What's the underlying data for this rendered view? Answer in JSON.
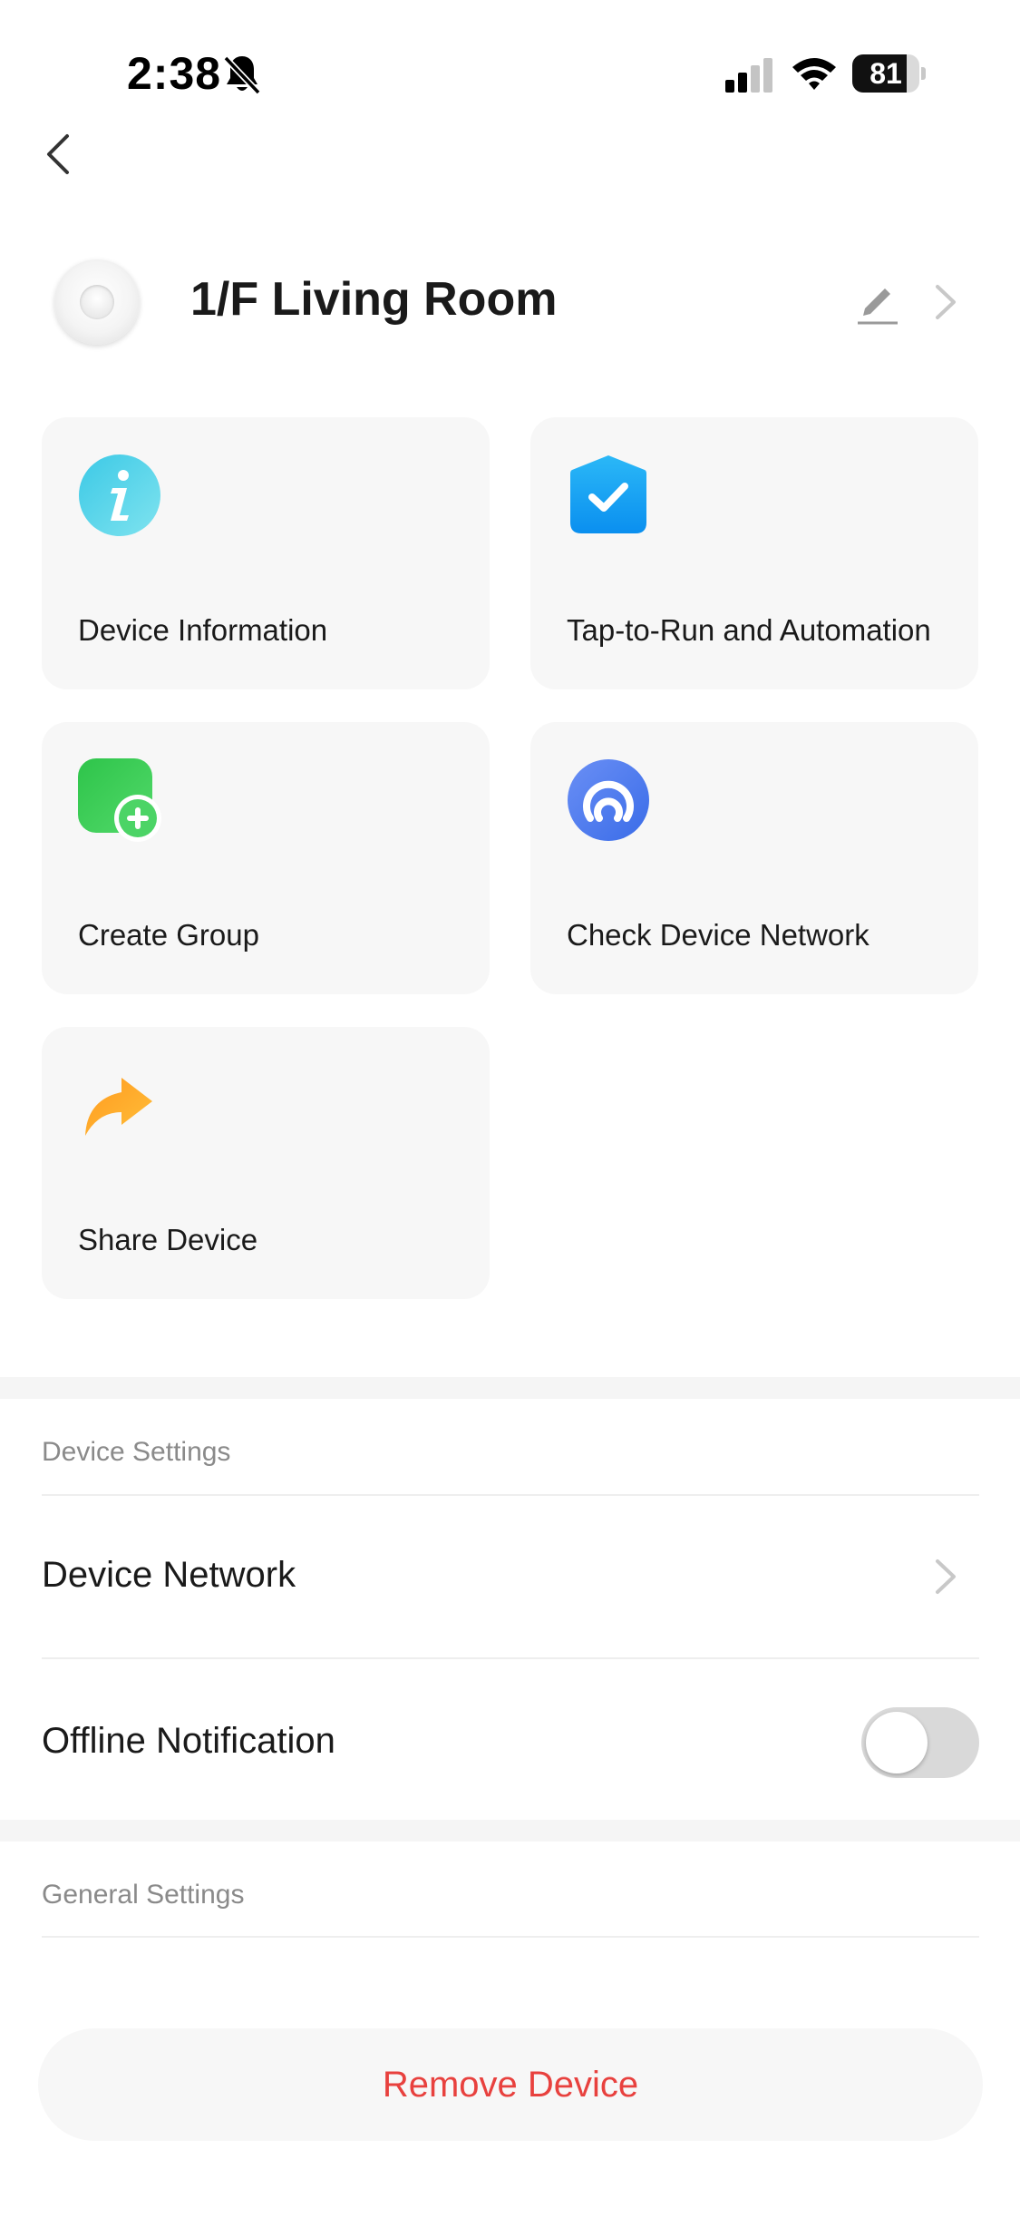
{
  "status_bar": {
    "time": "2:38",
    "battery_level": "81",
    "battery_fraction": 0.81
  },
  "header": {
    "device_name": "1/F Living Room"
  },
  "cards": [
    {
      "label": "Device Information",
      "icon": "info-icon"
    },
    {
      "label": "Tap-to-Run and Automation",
      "icon": "shield-check-icon"
    },
    {
      "label": "Create Group",
      "icon": "create-group-icon"
    },
    {
      "label": "Check Device Network",
      "icon": "network-check-icon"
    },
    {
      "label": "Share Device",
      "icon": "share-arrow-icon"
    }
  ],
  "device_settings": {
    "title": "Device Settings",
    "network_label": "Device Network",
    "offline_notification_label": "Offline Notification",
    "offline_notification_enabled": false
  },
  "general_settings": {
    "title": "General Settings"
  },
  "remove_button_label": "Remove Device",
  "colors": {
    "accent_red": "#e8413e",
    "info_cyan": "#4fd3e8",
    "shield_blue": "#1aa7f5",
    "group_green": "#3dcc56",
    "network_blue": "#4a7df0",
    "share_orange": "#f5a623"
  }
}
